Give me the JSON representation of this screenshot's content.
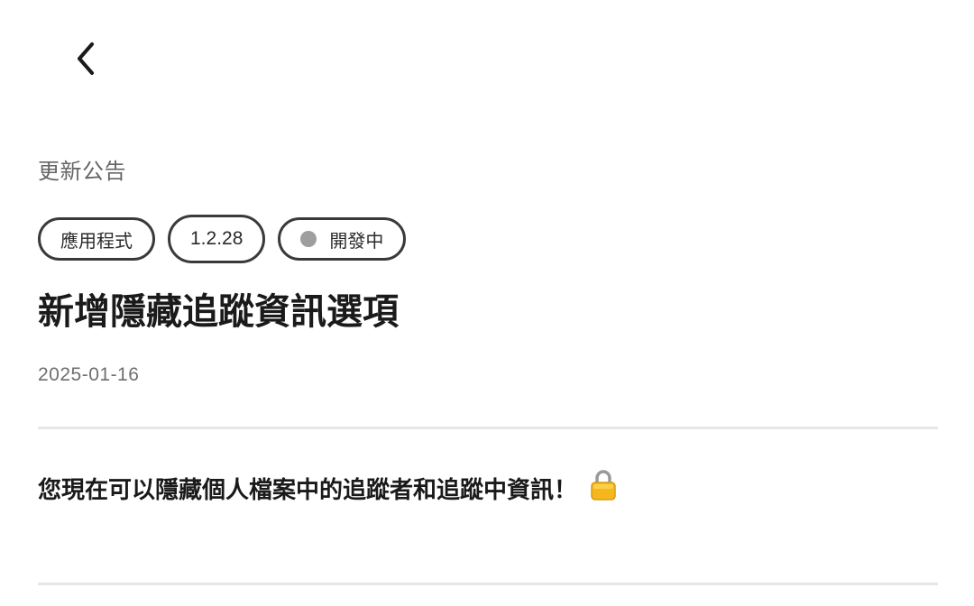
{
  "nav": {
    "back_icon": "chevron-left-icon"
  },
  "header": {
    "section_label": "更新公告"
  },
  "tags": {
    "category": "應用程式",
    "version": "1.2.28",
    "status": "開發中",
    "status_color": "#9e9e9e"
  },
  "article": {
    "title": "新增隱藏追蹤資訊選項",
    "date": "2025-01-16",
    "body": "您現在可以隱藏個人檔案中的追蹤者和追蹤中資訊！",
    "body_icon": "lock-icon"
  }
}
